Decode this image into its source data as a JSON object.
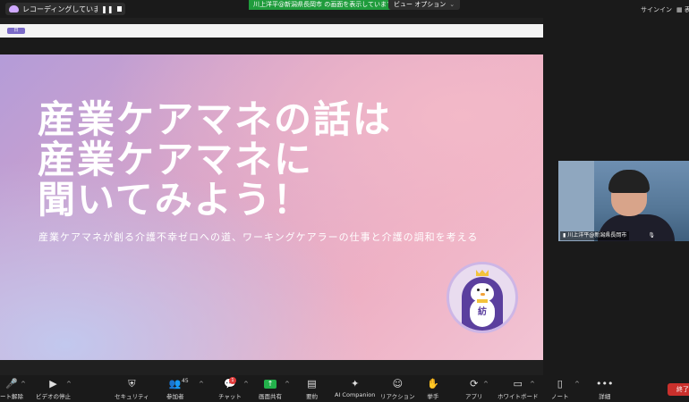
{
  "topbar": {
    "recording_text": "レコーディングしています...",
    "share_banner": "川上洋平@新潟県長岡市 の画面を表示しています",
    "view_options": "ビュー オプション",
    "signin": "サインイン",
    "view_partial": "表"
  },
  "slide": {
    "tag": "日",
    "title_lines": [
      "産業ケアマネの話は",
      "産業ケアマネに",
      "聞いてみよう！"
    ],
    "subtitle": "産業ケアマネが創る介護不幸ゼロへの道、ワーキングケアラーの仕事と介護の調和を考える",
    "mascot_char": "紡"
  },
  "video": {
    "name": "川上洋平@新潟県長岡市"
  },
  "toolbar": {
    "mute": "ート解除",
    "video": "ビデオの停止",
    "security": "セキュリティ",
    "participants": "参加者",
    "participants_count": "45",
    "chat": "チャット",
    "chat_badge": "1",
    "share": "画面共有",
    "summary": "要約",
    "ai": "AI Companion",
    "reaction": "リアクション",
    "raise_hand": "挙手",
    "apps": "アプリ",
    "whiteboard": "ホワイトボード",
    "notes": "ノート",
    "more": "詳細",
    "end": "終了"
  },
  "colors": {
    "share_green": "#1f9c3c",
    "end_red": "#c9302c",
    "mascot_purple": "#5b3f9e"
  }
}
